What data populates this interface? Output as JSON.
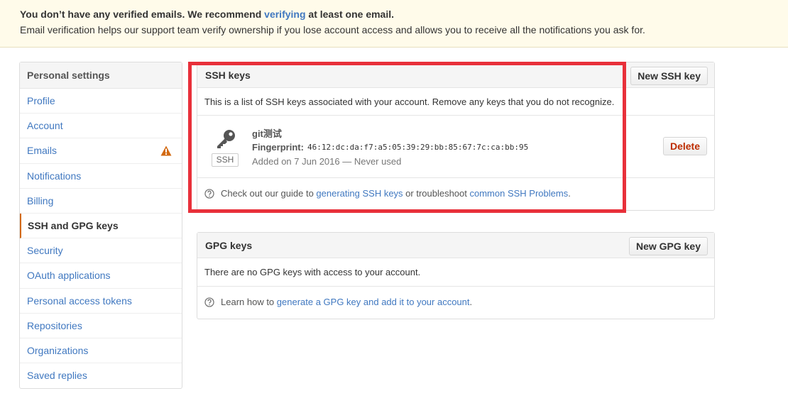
{
  "banner": {
    "line1_pre": "You don’t have any verified emails. We recommend ",
    "line1_link": "verifying",
    "line1_post": " at least one email.",
    "line2": "Email verification helps our support team verify ownership if you lose account access and allows you to receive all the notifications you ask for."
  },
  "sidebar": {
    "heading": "Personal settings",
    "items": [
      {
        "label": "Profile"
      },
      {
        "label": "Account"
      },
      {
        "label": "Emails",
        "icon": "warning-icon"
      },
      {
        "label": "Notifications"
      },
      {
        "label": "Billing"
      },
      {
        "label": "SSH and GPG keys",
        "selected": true
      },
      {
        "label": "Security"
      },
      {
        "label": "OAuth applications"
      },
      {
        "label": "Personal access tokens"
      },
      {
        "label": "Repositories"
      },
      {
        "label": "Organizations"
      },
      {
        "label": "Saved replies"
      }
    ]
  },
  "ssh": {
    "title": "SSH keys",
    "new_button": "New SSH key",
    "description": "This is a list of SSH keys associated with your account. Remove any keys that you do not recognize.",
    "key": {
      "type_label": "SSH",
      "title": "git测试",
      "fingerprint_label": "Fingerprint:",
      "fingerprint": "46:12:dc:da:f7:a5:05:39:29:bb:85:67:7c:ca:bb:95",
      "added": "Added on 7 Jun 2016 — Never used",
      "delete_button": "Delete"
    },
    "help": {
      "pre": "Check out our guide to ",
      "link1": "generating SSH keys",
      "mid": " or troubleshoot ",
      "link2": "common SSH Problems",
      "post": "."
    }
  },
  "gpg": {
    "title": "GPG keys",
    "new_button": "New GPG key",
    "description": "There are no GPG keys with access to your account.",
    "help": {
      "pre": "Learn how to ",
      "link": "generate a GPG key and add it to your account",
      "post": "."
    }
  },
  "colors": {
    "link": "#4078c0",
    "highlight": "#e8303a",
    "warning": "#d26911",
    "danger": "#bd2c00"
  }
}
